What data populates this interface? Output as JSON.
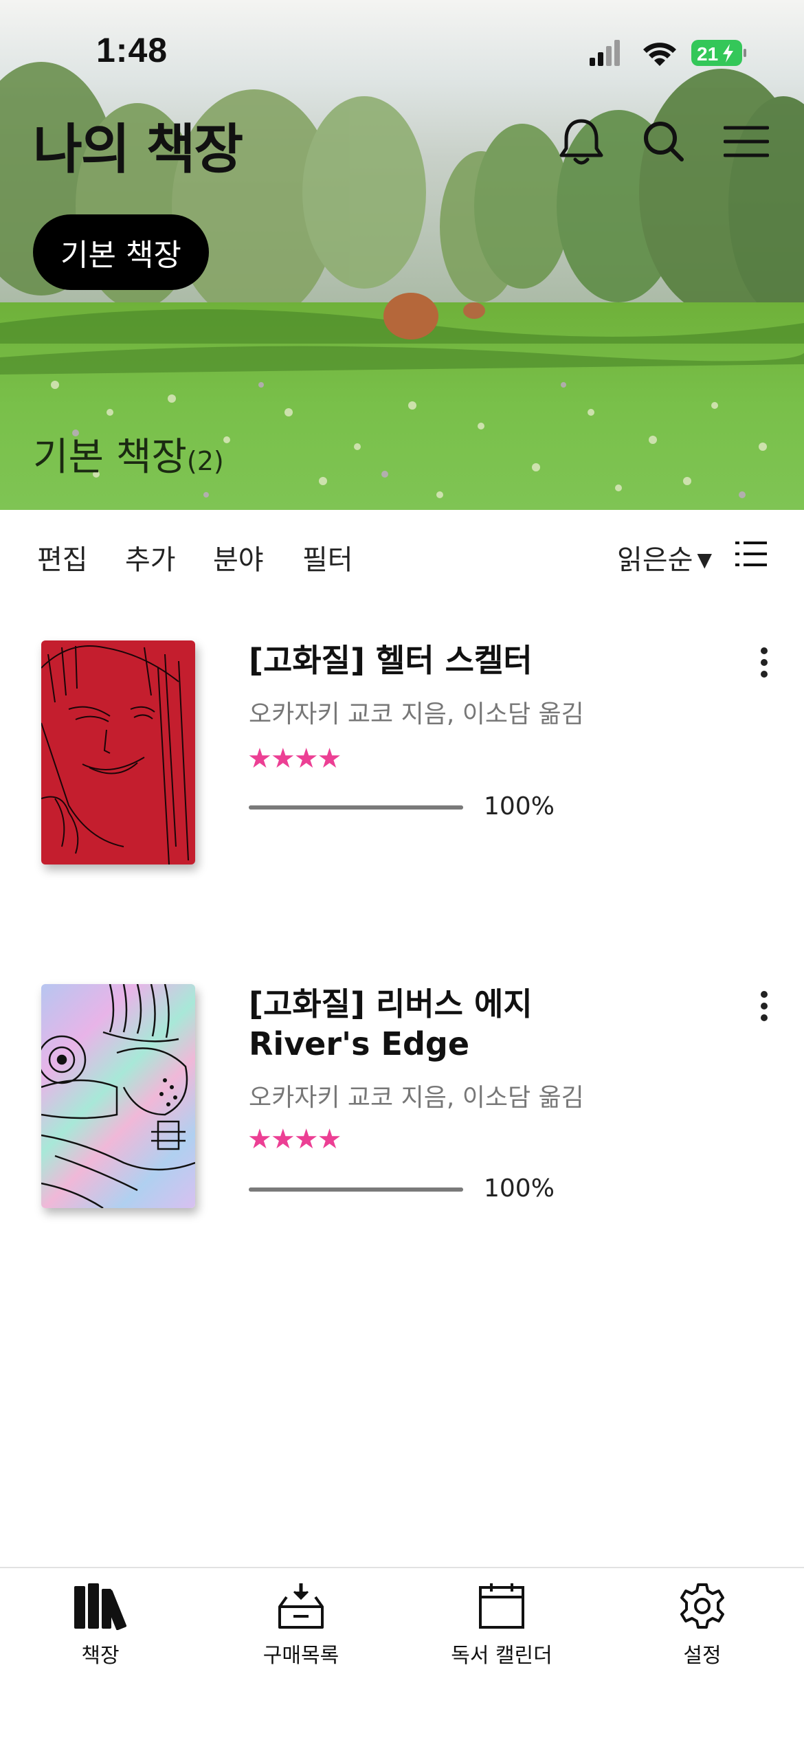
{
  "status_bar": {
    "time": "1:48",
    "battery_level": "21",
    "icons": [
      "cellular-signal-icon",
      "wifi-icon",
      "battery-charging-icon"
    ]
  },
  "header": {
    "title": "나의 책장",
    "icons": [
      "bell-icon",
      "search-icon",
      "menu-icon"
    ],
    "shelf_chip": "기본 책장",
    "shelf_heading": "기본 책장",
    "shelf_count": "(2)"
  },
  "toolbar": {
    "edit": "편집",
    "add": "추가",
    "category": "분야",
    "filter": "필터",
    "sort": "읽은순",
    "list_view_icon": "list-view-icon"
  },
  "books": [
    {
      "title_line1": "[고화질] 헬터 스켈터",
      "title_line2": "",
      "author": "오카자키 교코 지음, 이소담 옮김",
      "rating": 4,
      "progress": 1.0,
      "progress_label": "100%"
    },
    {
      "title_line1": "[고화질] 리버스 에지",
      "title_line2": "River's Edge",
      "author": "오카자키 교코 지음, 이소담 옮김",
      "rating": 4,
      "progress": 1.0,
      "progress_label": "100%"
    }
  ],
  "tabbar": {
    "tabs": [
      {
        "label": "책장",
        "icon": "bookshelf-icon"
      },
      {
        "label": "구매목록",
        "icon": "purchase-box-icon"
      },
      {
        "label": "독서 캘린더",
        "icon": "calendar-icon"
      },
      {
        "label": "설정",
        "icon": "gear-icon"
      }
    ]
  },
  "colors": {
    "star": "#ec3f94",
    "chip_bg": "#000000",
    "cover1": "#c41e2e"
  }
}
